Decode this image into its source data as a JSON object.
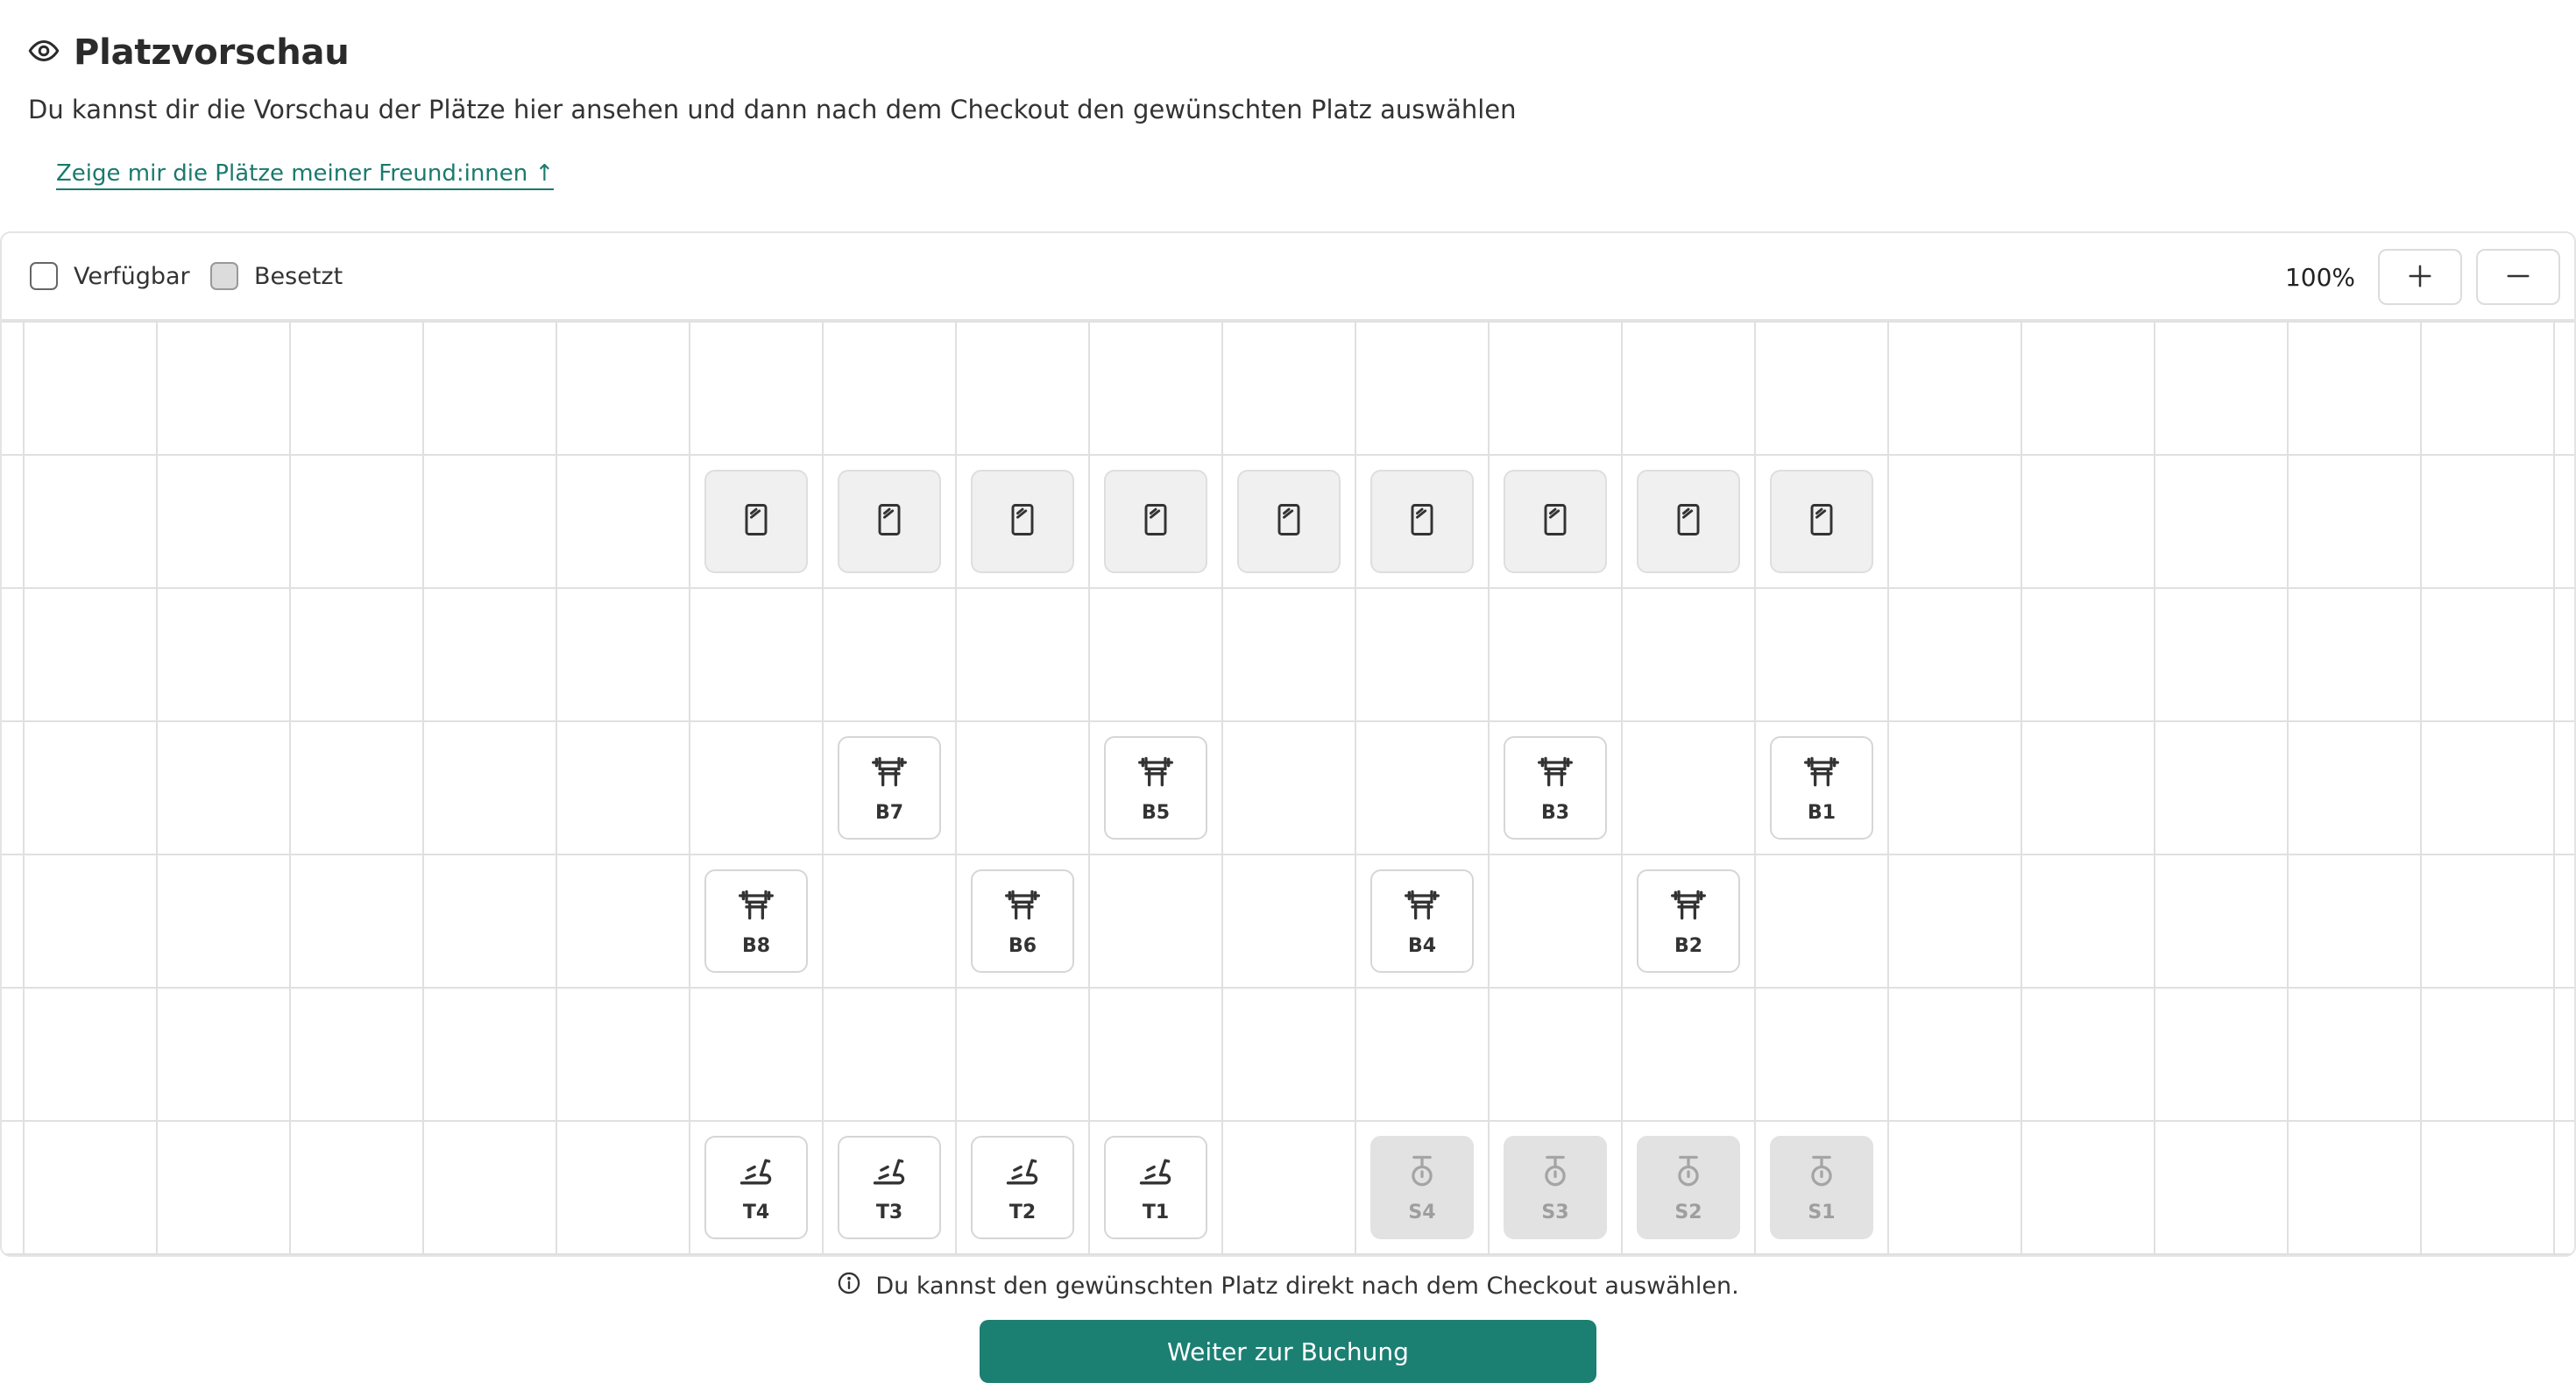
{
  "header": {
    "title": "Platzvorschau",
    "subtitle": "Du kannst dir die Vorschau der Plätze hier ansehen und dann nach dem Checkout den gewünschten Platz auswählen",
    "friends_link": "Zeige mir die Plätze meiner Freund:innen ↑"
  },
  "legend": {
    "available": "Verfügbar",
    "occupied": "Besetzt"
  },
  "zoom": {
    "level": "100%",
    "zoom_in_icon": "plus-icon",
    "zoom_out_icon": "minus-icon"
  },
  "seats": {
    "mirrors": [
      "",
      "",
      "",
      "",
      "",
      "",
      "",
      "",
      ""
    ],
    "bench_row_a": [
      "B7",
      "B5",
      "B3",
      "B1"
    ],
    "bench_row_b": [
      "B8",
      "B6",
      "B4",
      "B2"
    ],
    "treadmills": [
      "T4",
      "T3",
      "T2",
      "T1"
    ],
    "stations": [
      "S4",
      "S3",
      "S2",
      "S1"
    ]
  },
  "footer": {
    "info": "Du kannst den gewünschten Platz direkt nach dem Checkout auswählen.",
    "cta": "Weiter zur Buchung"
  },
  "colors": {
    "accent": "#1b7f72",
    "link": "#1a7a6d",
    "occupied": "#e2e2e2"
  }
}
